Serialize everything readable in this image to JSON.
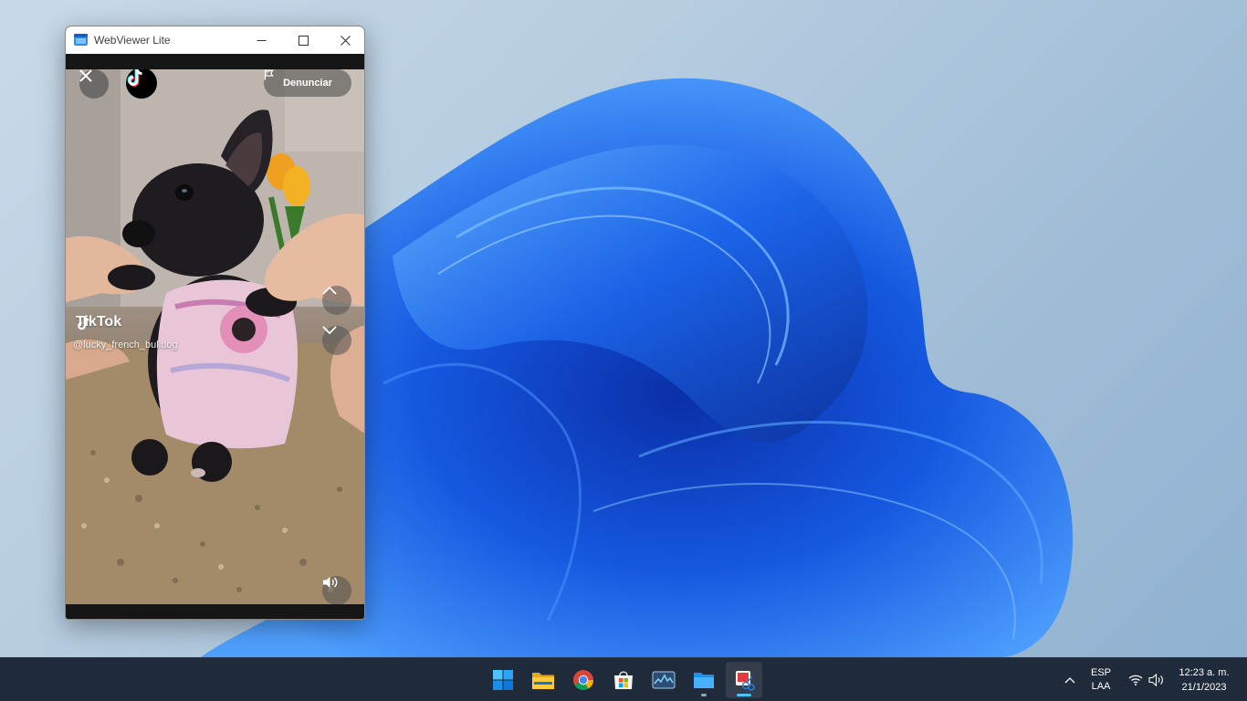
{
  "window": {
    "title": "WebViewer Lite",
    "controls": {
      "minimize": "minimize",
      "maximize": "maximize",
      "close": "close"
    }
  },
  "video": {
    "report_label": "Denunciar",
    "watermark_brand": "TikTok",
    "watermark_user": "@lucky_french_bulldog",
    "icons": [
      "close-icon",
      "tiktok-logo-icon",
      "flag-icon",
      "chevron-up-icon",
      "chevron-down-icon",
      "volume-icon"
    ]
  },
  "taskbar": {
    "apps": [
      "start",
      "file-explorer",
      "chrome",
      "microsoft-store",
      "task-manager",
      "files",
      "snipping-tool"
    ],
    "language": {
      "code": "ESP",
      "layout": "LAA"
    },
    "clock": {
      "time": "12:23 a. m.",
      "date": "21/1/2023"
    }
  },
  "colors": {
    "accent": "#0067c0",
    "taskbar": "#1f2a3a",
    "bloom": "#1a5fe0"
  }
}
